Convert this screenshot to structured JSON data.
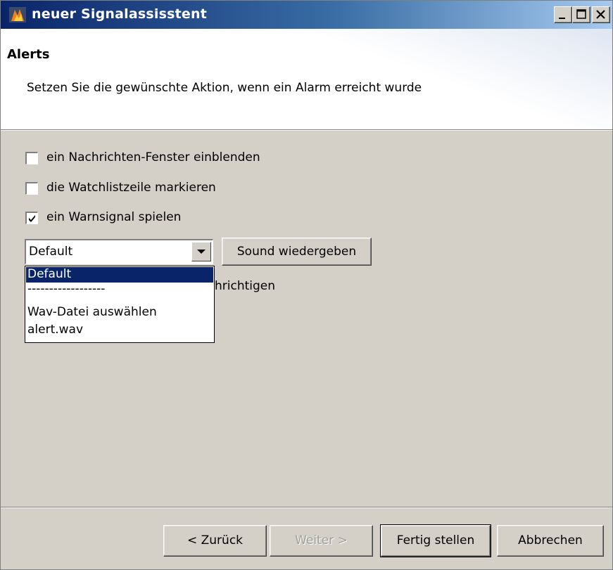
{
  "window": {
    "title": "neuer Signalassisstent",
    "title_buttons": [
      "minimize-button",
      "maximize-button",
      "close-button"
    ]
  },
  "header": {
    "title": "Alerts",
    "description": "Setzen Sie die gewünschte Aktion, wenn ein Alarm erreicht wurde"
  },
  "options": [
    {
      "label": "ein Nachrichten-Fenster einblenden",
      "checked": false
    },
    {
      "label": "die Watchlistzeile markieren",
      "checked": false
    },
    {
      "label": "ein Warnsignal spielen",
      "checked": true
    }
  ],
  "sound": {
    "selected": "Default",
    "play_button": "Sound wiedergeben",
    "dropdown_items": [
      "Default",
      "------------------",
      "Wav-Datei auswählen",
      "alert.wav"
    ],
    "highlighted_index": 0
  },
  "partially_hidden_label": "hrichtigen",
  "footer": {
    "back": "< Zurück",
    "next": "Weiter >",
    "finish": "Fertig stellen",
    "cancel": "Abbrechen"
  },
  "colors": {
    "title_gradient_start": "#0a246a",
    "title_gradient_end": "#a6caf0",
    "dialog_face": "#d4d0c8",
    "selection": "#0a246a"
  },
  "icons": {
    "app": "application-flame-icon",
    "check": "checkmark-icon",
    "combo_arrow": "dropdown-arrow-icon"
  }
}
